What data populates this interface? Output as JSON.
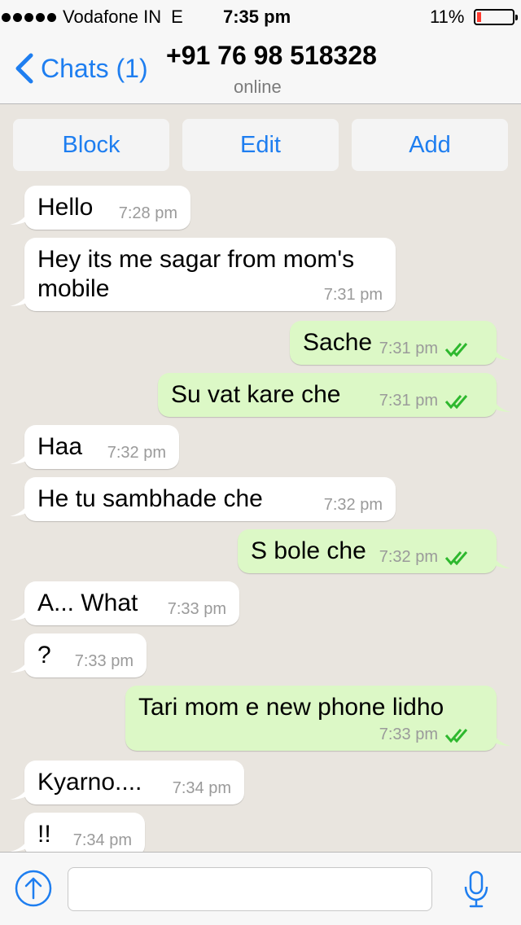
{
  "status_bar": {
    "carrier": "Vodafone IN",
    "network": "E",
    "time": "7:35 pm",
    "battery": "11%"
  },
  "nav": {
    "back_label": "Chats (1)",
    "contact": "+91 76 98 518328",
    "status": "online"
  },
  "actions": {
    "block": "Block",
    "edit": "Edit",
    "add": "Add"
  },
  "messages": [
    {
      "dir": "in",
      "text": "Hello",
      "time": "7:28 pm"
    },
    {
      "dir": "in",
      "text": "Hey its me sagar from mom's",
      "text2": "mobile",
      "time": "7:31 pm"
    },
    {
      "dir": "out",
      "text": "Sache",
      "time": "7:31 pm"
    },
    {
      "dir": "out",
      "text": "Su vat kare che",
      "time": "7:31 pm"
    },
    {
      "dir": "in",
      "text": "Haa",
      "time": "7:32 pm"
    },
    {
      "dir": "in",
      "text": "He tu sambhade che",
      "time": "7:32 pm"
    },
    {
      "dir": "out",
      "text": "S bole che",
      "time": "7:32 pm"
    },
    {
      "dir": "in",
      "text": "A... What",
      "time": "7:33 pm"
    },
    {
      "dir": "in",
      "text": "?",
      "time": "7:33 pm"
    },
    {
      "dir": "out",
      "text": "Tari mom e new phone lidho",
      "time": "7:33 pm"
    },
    {
      "dir": "in",
      "text": "Kyarno....",
      "time": "7:34 pm"
    },
    {
      "dir": "in",
      "text": "!!",
      "time": "7:34 pm"
    }
  ],
  "input": {
    "placeholder": ""
  },
  "colors": {
    "accent": "#1e7ef0",
    "incoming_bubble": "#ffffff",
    "outgoing_bubble": "#dcf8c6",
    "chat_background": "#e9e5df",
    "read_tick": "#2eb82e"
  },
  "icons": {
    "back": "chevron-left-icon",
    "read": "double-check-icon",
    "send": "arrow-up-circle-icon",
    "mic": "microphone-icon"
  }
}
